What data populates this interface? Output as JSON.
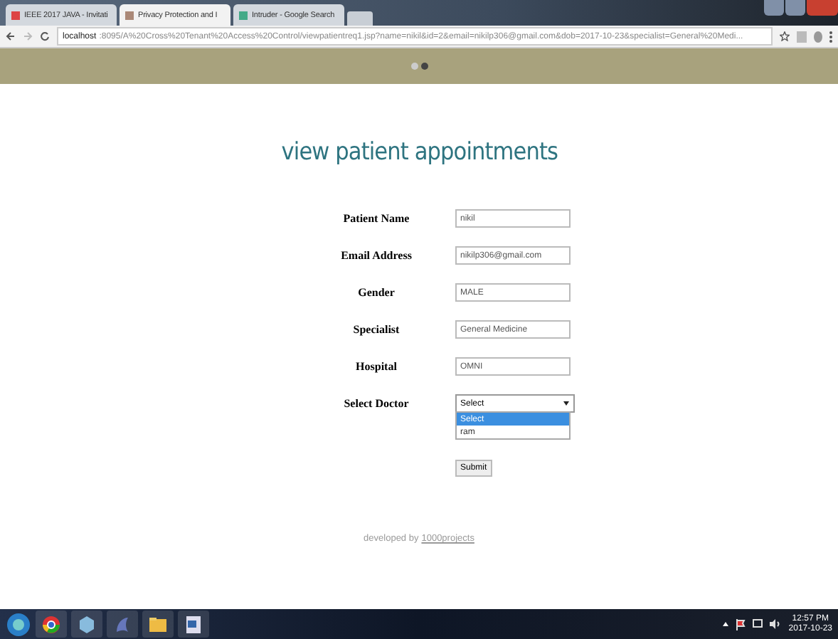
{
  "browser": {
    "tabs": [
      {
        "title": "IEEE 2017 JAVA - Invitati",
        "selected": false
      },
      {
        "title": "Privacy Protection and I",
        "selected": true
      },
      {
        "title": "Intruder - Google Search",
        "selected": false
      }
    ],
    "url_host": "localhost",
    "url_rest": ":8095/A%20Cross%20Tenant%20Access%20Control/viewpatientreq1.jsp?name=nikil&id=2&email=nikilp306@gmail.com&dob=2017-10-23&specialist=General%20Medi..."
  },
  "banner": {
    "dots": [
      {
        "selected": false
      },
      {
        "selected": true
      }
    ]
  },
  "heading": "view patient appointments",
  "form": {
    "fields": [
      {
        "kind": "text",
        "label": "Patient Name",
        "value": "nikil"
      },
      {
        "kind": "text",
        "label": "Email Address",
        "value": "nikilp306@gmail.com"
      },
      {
        "kind": "text",
        "label": "Gender",
        "value": "MALE"
      },
      {
        "kind": "text",
        "label": "Specialist",
        "value": "General Medicine"
      },
      {
        "kind": "text",
        "label": "Hospital",
        "value": "OMNI"
      },
      {
        "kind": "select",
        "label": "Select Doctor",
        "value": "Select",
        "expanded": true,
        "options": [
          {
            "label": "Select",
            "selected": true
          },
          {
            "label": "ram",
            "selected": false
          }
        ]
      }
    ],
    "submit": "Submit"
  },
  "footer": {
    "text": "developed by",
    "link": "1000projects"
  },
  "taskbar": {
    "time": "12:57 PM",
    "date": "2017-10-23"
  }
}
